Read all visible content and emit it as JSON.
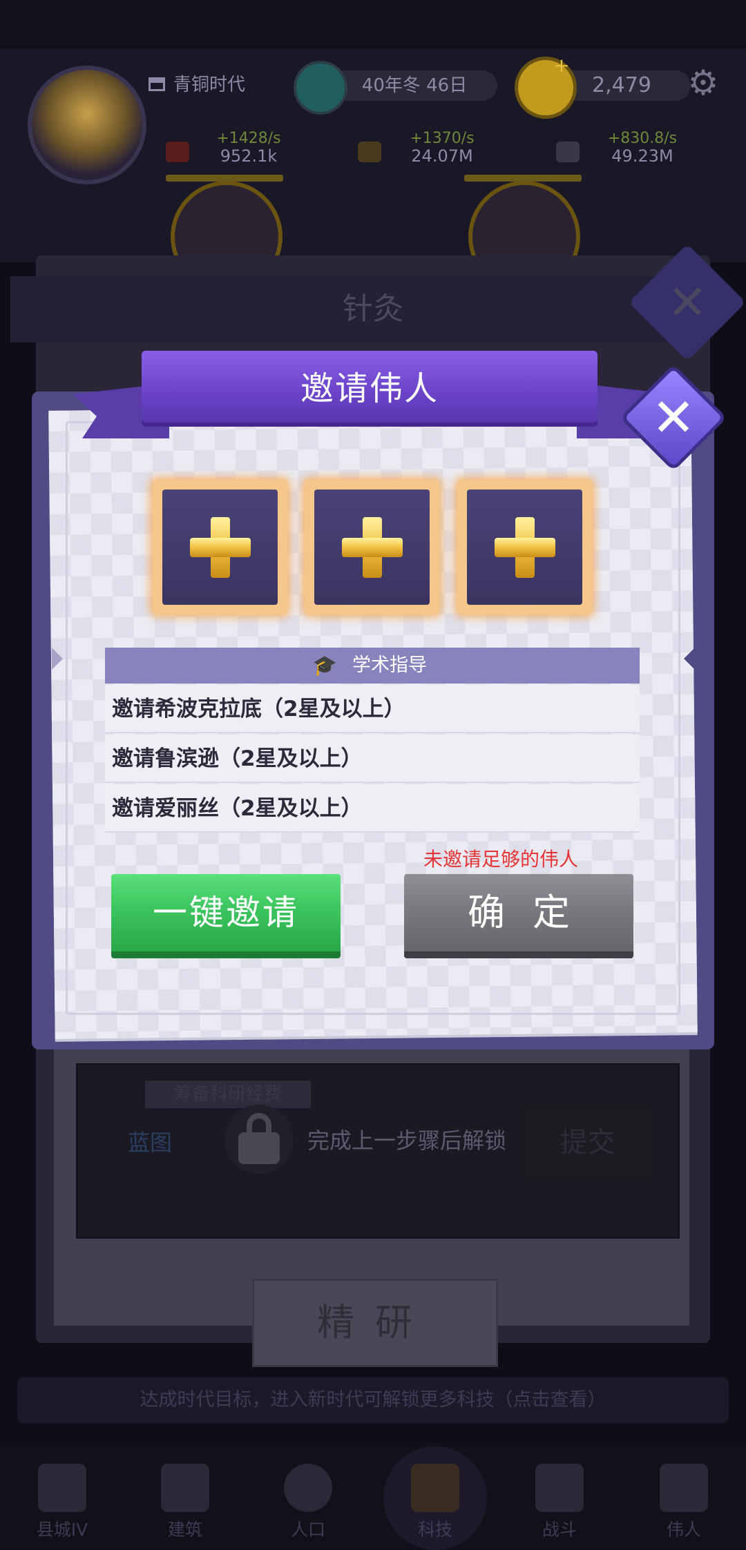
{
  "hud": {
    "era_label": "青铜时代",
    "season_label": "40年冬 46日",
    "coins": "2,479",
    "resources": [
      {
        "rate": "+1428/s",
        "amount": "952.1k"
      },
      {
        "rate": "+1370/s",
        "amount": "24.07M"
      },
      {
        "rate": "+830.8/s",
        "amount": "49.23M"
      }
    ]
  },
  "underlying": {
    "title": "针灸",
    "budget_label": "筹备科研经费",
    "blueprint_label": "蓝图",
    "unlock_text": "完成上一步骤后解锁",
    "submit_label": "提交",
    "refine_label": "精研",
    "banner_text": "达成时代目标，进入新时代可解锁更多科技（点击查看）"
  },
  "nav": [
    {
      "label": "县城IV",
      "icon": "town-icon"
    },
    {
      "label": "建筑",
      "icon": "building-icon"
    },
    {
      "label": "人口",
      "icon": "population-icon"
    },
    {
      "label": "科技",
      "icon": "book-icon"
    },
    {
      "label": "战斗",
      "icon": "swords-icon"
    },
    {
      "label": "伟人",
      "icon": "person-icon"
    }
  ],
  "modal": {
    "title": "邀请伟人",
    "slots": [
      "empty",
      "empty",
      "empty"
    ],
    "requirement_header": "学术指导",
    "requirements": [
      "邀请希波克拉底（2星及以上）",
      "邀请鲁滨逊（2星及以上）",
      "邀请爱丽丝（2星及以上）"
    ],
    "warning": "未邀请足够的伟人",
    "invite_all_label": "一键邀请",
    "confirm_label": "确定"
  },
  "colors": {
    "accent_purple": "#6b44c9",
    "green_button": "#3cc55e",
    "warning_red": "#e53535",
    "slot_glow": "#f4b36a"
  }
}
